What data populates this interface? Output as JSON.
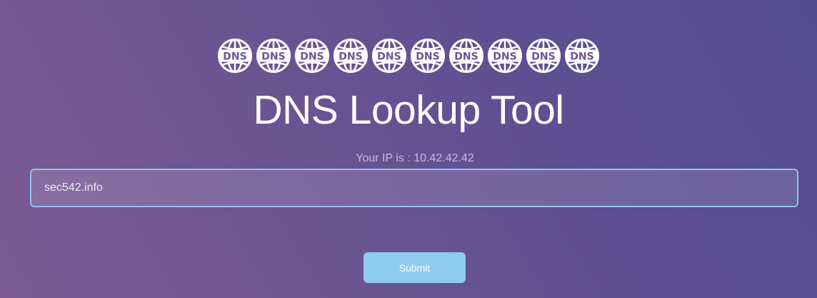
{
  "header": {
    "icon_name": "dns-globe-icon",
    "icon_count": 10,
    "icon_label": "DNS",
    "title": "DNS Lookup Tool"
  },
  "ip_info": {
    "text": "Your IP is : 10.42.42.42"
  },
  "form": {
    "domain_value": "sec542.info",
    "submit_label": "Submit"
  },
  "colors": {
    "background_start": "#7d5a93",
    "background_end": "#554c90",
    "input_border": "#8fc3ee",
    "button_background": "#8ecbf1"
  }
}
